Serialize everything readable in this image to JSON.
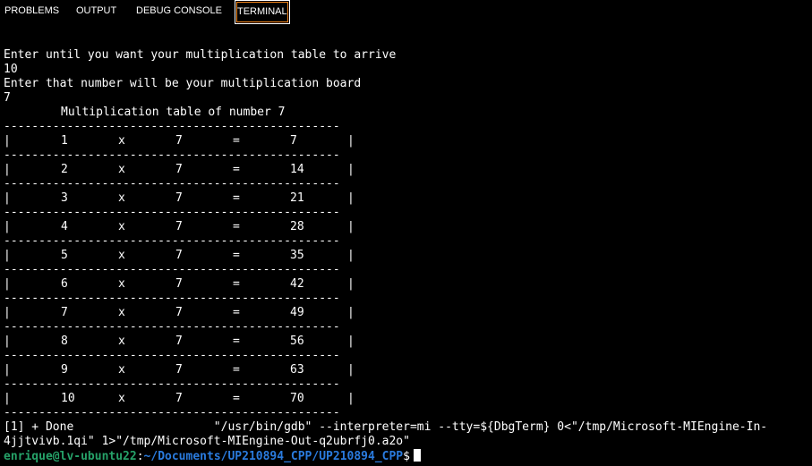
{
  "tabs": [
    {
      "label": "PROBLEMS",
      "active": false
    },
    {
      "label": "OUTPUT",
      "active": false
    },
    {
      "label": "DEBUG CONSOLE",
      "active": false
    },
    {
      "label": "TERMINAL",
      "active": true
    }
  ],
  "colors": {
    "background": "#000000",
    "text": "#ffffff",
    "active_tab_outline": "#f38518",
    "prompt_user": "#26a269",
    "prompt_path": "#2a7bde"
  },
  "terminal": {
    "prompt1": "Enter until you want your multiplication table to arrive",
    "input1": "10",
    "prompt2": "Enter that number will be your multiplication board",
    "input2": "7",
    "table_title": "Multiplication table of number 7",
    "separator": "------------------------------------------------",
    "border": "|",
    "times_symbol": "x",
    "equals_symbol": "=",
    "multiplier": "7",
    "rows": [
      {
        "n": "1",
        "result": "7"
      },
      {
        "n": "2",
        "result": "14"
      },
      {
        "n": "3",
        "result": "21"
      },
      {
        "n": "4",
        "result": "28"
      },
      {
        "n": "5",
        "result": "35"
      },
      {
        "n": "6",
        "result": "42"
      },
      {
        "n": "7",
        "result": "49"
      },
      {
        "n": "8",
        "result": "56"
      },
      {
        "n": "9",
        "result": "63"
      },
      {
        "n": "10",
        "result": "70"
      }
    ],
    "job_done_line1": "[1] + Done                    \"/usr/bin/gdb\" --interpreter=mi --tty=${DbgTerm} 0<\"/tmp/Microsoft-MIEngine-In-",
    "job_done_line2": "4jjtvivb.1qi\" 1>\"/tmp/Microsoft-MIEngine-Out-q2ubrfj0.a2o\"",
    "prompt_user_host": "enrique@lv-ubuntu22",
    "prompt_colon": ":",
    "prompt_path": "~/Documents/UP210894_CPP/UP210894_CPP",
    "prompt_dollar": "$"
  }
}
